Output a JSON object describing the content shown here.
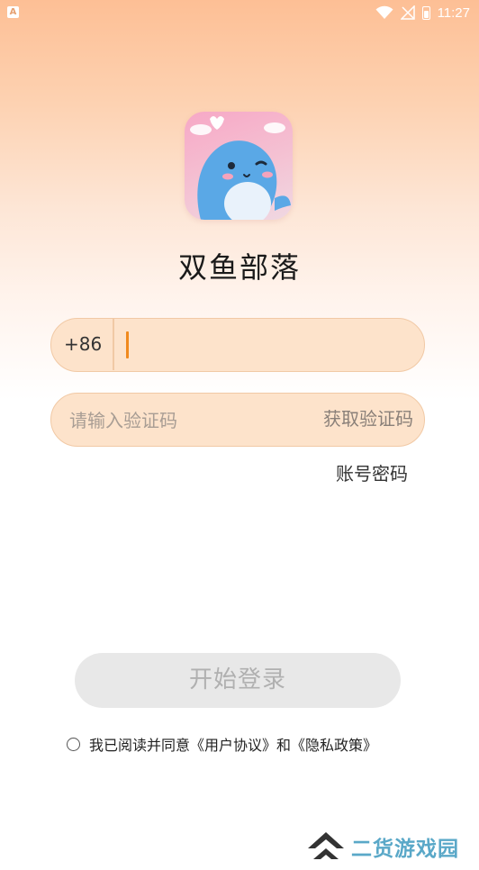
{
  "status_bar": {
    "time": "11:27",
    "app_badge": "A"
  },
  "app": {
    "name": "双鱼部落"
  },
  "phone_field": {
    "prefix": "+86",
    "value": ""
  },
  "code_field": {
    "placeholder": "请输入验证码",
    "get_code_label": "获取验证码"
  },
  "links": {
    "password_login": "账号密码"
  },
  "login_button": {
    "label": "开始登录"
  },
  "agreement": {
    "text": "我已阅读并同意《用户协议》和《隐私政策》",
    "checked": false
  },
  "watermark": {
    "text": "二货游戏园"
  },
  "colors": {
    "accent": "#f08a1e",
    "field_bg": "#fde3cb",
    "field_border": "#f1c9a5",
    "button_disabled": "#e8e8e8"
  }
}
